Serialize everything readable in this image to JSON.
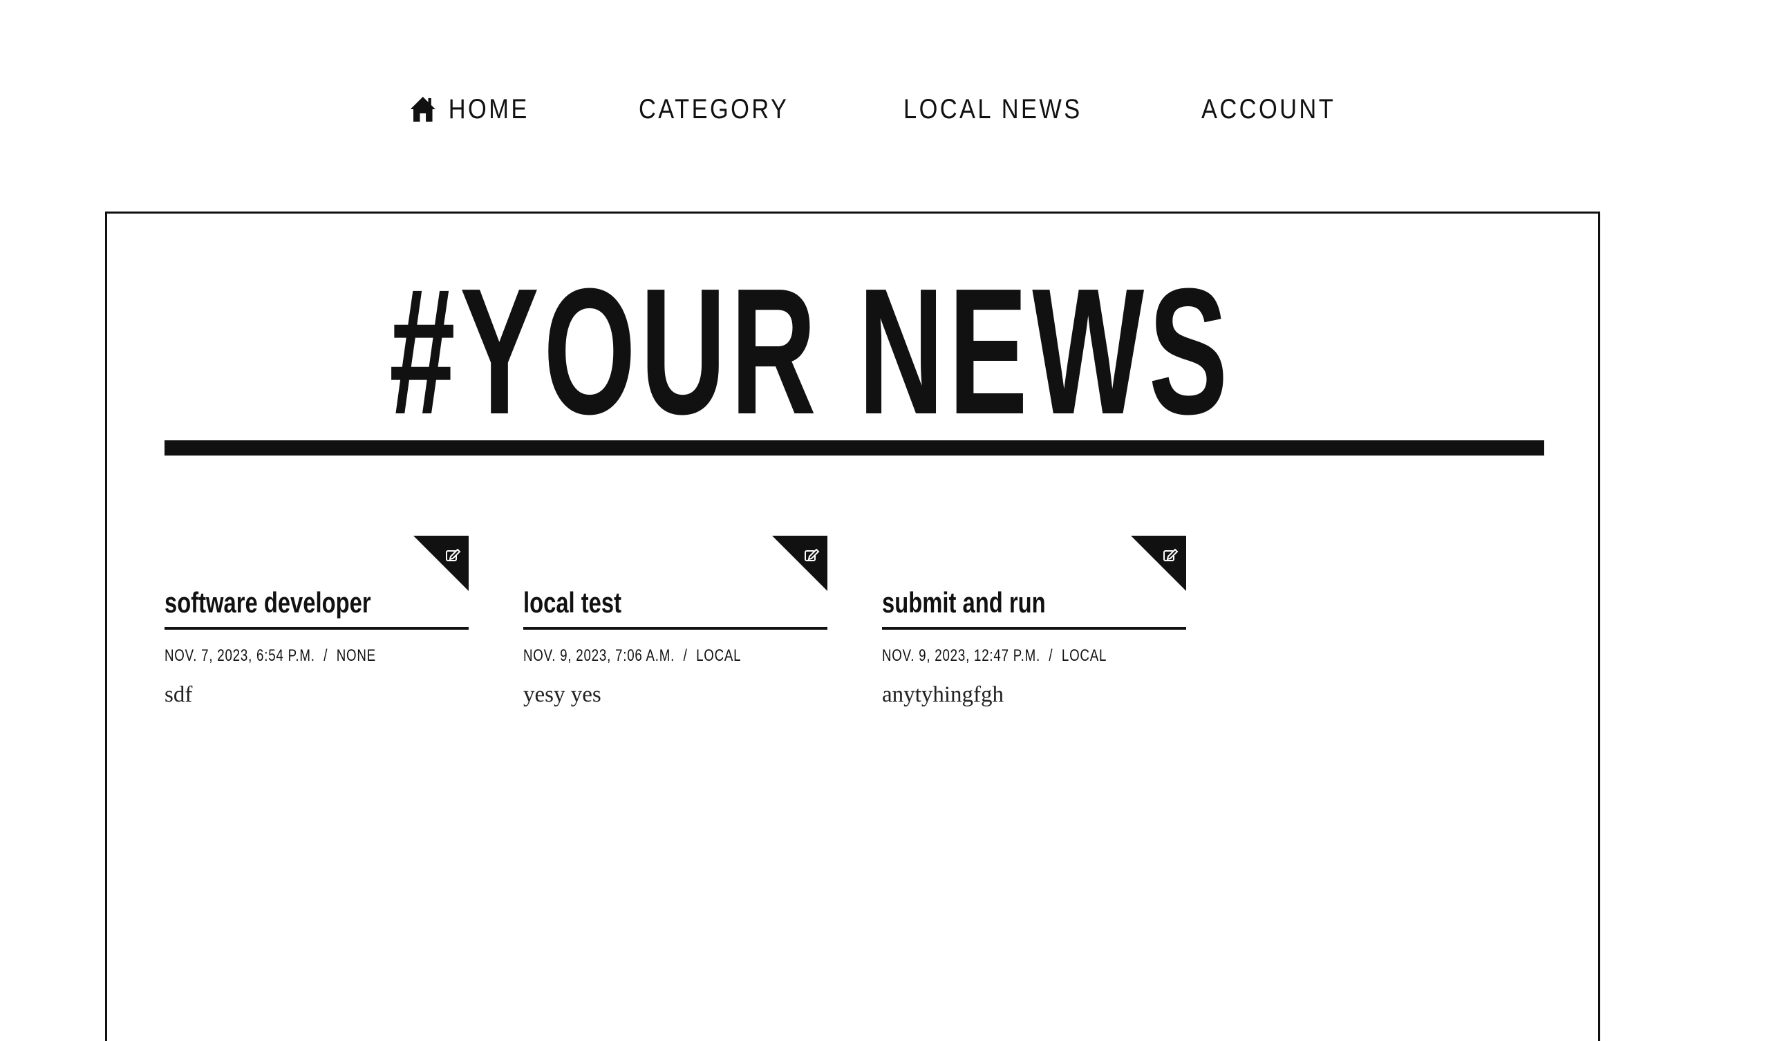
{
  "nav": {
    "items": [
      {
        "label": "HOME",
        "icon": "home-icon"
      },
      {
        "label": "CATEGORY"
      },
      {
        "label": "LOCAL NEWS"
      },
      {
        "label": "ACCOUNT"
      }
    ]
  },
  "masthead": {
    "title": "#YOUR NEWS"
  },
  "articles": [
    {
      "title": "software developer",
      "date": "NOV. 7, 2023, 6:54 P.M.",
      "category": "NONE",
      "body": "sdf",
      "corner_icon": "edit-icon"
    },
    {
      "title": "local test",
      "date": "NOV. 9, 2023, 7:06 A.M.",
      "category": "LOCAL",
      "body": "yesy yes",
      "corner_icon": "edit-icon"
    },
    {
      "title": "submit and run",
      "date": "NOV. 9, 2023, 12:47 P.M.",
      "category": "LOCAL",
      "body": "anytyhingfgh",
      "corner_icon": "edit-icon"
    }
  ],
  "meta_separator": "/",
  "colors": {
    "ink": "#111111",
    "background": "#ffffff"
  }
}
